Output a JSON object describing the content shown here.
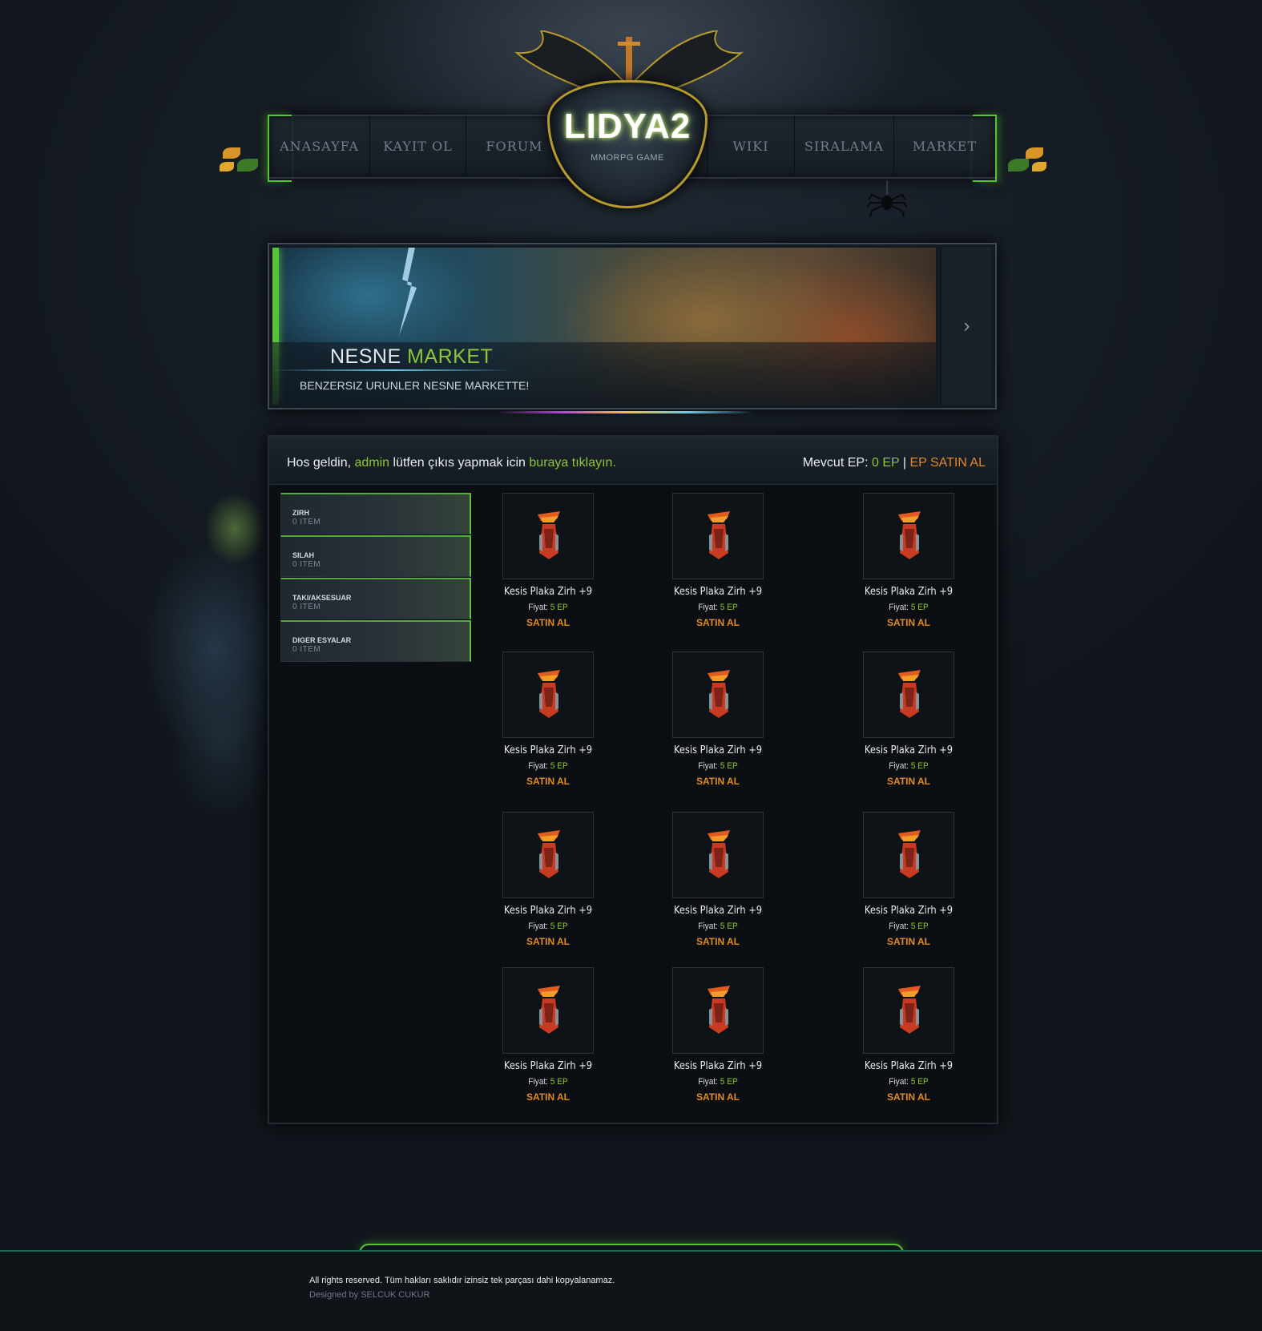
{
  "nav": {
    "items": [
      {
        "label": "ANASAYFA"
      },
      {
        "label": "KAYIT OL"
      },
      {
        "label": "FORUM"
      },
      {
        "label": "WIKI"
      },
      {
        "label": "SIRALAMA"
      },
      {
        "label": "MARKET"
      }
    ]
  },
  "logo": {
    "title": "LIDYA2",
    "subtitle": "MMORPG GAME"
  },
  "banner": {
    "title_part1": "NESNE",
    "title_part2": "MARKET",
    "subtitle": "BENZERSIZ URUNLER NESNE MARKETTE!",
    "next_symbol": "›"
  },
  "welcome": {
    "prefix": "Hos geldin,",
    "username": "admin",
    "middle": "lütfen çıkıs yapmak icin",
    "link": "buraya tıklayın."
  },
  "ep": {
    "label": "Mevcut EP:",
    "value": "0 EP",
    "separator": "|",
    "buy_label": "EP SATIN AL"
  },
  "categories": [
    {
      "name": "ZIRH",
      "count": "0 ITEM"
    },
    {
      "name": "SILAH",
      "count": "0 ITEM"
    },
    {
      "name": "TAKI/AKSESUAR",
      "count": "0 ITEM"
    },
    {
      "name": "DIGER ESYALAR",
      "count": "0 ITEM"
    }
  ],
  "items": [
    {
      "name": "Kesis Plaka Zirh +9",
      "price_label": "Fiyat:",
      "price": "5 EP",
      "buy": "SATIN AL"
    },
    {
      "name": "Kesis Plaka Zirh +9",
      "price_label": "Fiyat:",
      "price": "5 EP",
      "buy": "SATIN AL"
    },
    {
      "name": "Kesis Plaka Zirh +9",
      "price_label": "Fiyat:",
      "price": "5 EP",
      "buy": "SATIN AL"
    },
    {
      "name": "Kesis Plaka Zirh +9",
      "price_label": "Fiyat:",
      "price": "5 EP",
      "buy": "SATIN AL"
    },
    {
      "name": "Kesis Plaka Zirh +9",
      "price_label": "Fiyat:",
      "price": "5 EP",
      "buy": "SATIN AL"
    },
    {
      "name": "Kesis Plaka Zirh +9",
      "price_label": "Fiyat:",
      "price": "5 EP",
      "buy": "SATIN AL"
    },
    {
      "name": "Kesis Plaka Zirh +9",
      "price_label": "Fiyat:",
      "price": "5 EP",
      "buy": "SATIN AL"
    },
    {
      "name": "Kesis Plaka Zirh +9",
      "price_label": "Fiyat:",
      "price": "5 EP",
      "buy": "SATIN AL"
    },
    {
      "name": "Kesis Plaka Zirh +9",
      "price_label": "Fiyat:",
      "price": "5 EP",
      "buy": "SATIN AL"
    },
    {
      "name": "Kesis Plaka Zirh +9",
      "price_label": "Fiyat:",
      "price": "5 EP",
      "buy": "SATIN AL"
    },
    {
      "name": "Kesis Plaka Zirh +9",
      "price_label": "Fiyat:",
      "price": "5 EP",
      "buy": "SATIN AL"
    },
    {
      "name": "Kesis Plaka Zirh +9",
      "price_label": "Fiyat:",
      "price": "5 EP",
      "buy": "SATIN AL"
    }
  ],
  "footer": {
    "copyright": "All rights reserved. Tüm hakları saklıdır izinsiz tek parçası dahi kopyalanamaz.",
    "designer": "Designed by SELCUK CUKUR"
  },
  "colors": {
    "accent_green": "#8ec63a",
    "accent_orange": "#e08a22",
    "frame_green": "#58c23a",
    "logo_gold": "#b79a2c"
  },
  "icons": {
    "item": "armor-icon",
    "banner_next": "chevron-right-icon",
    "decor": [
      "bat-wings-icon",
      "spider-icon",
      "leaf-ornament-icon",
      "lightning-icon"
    ]
  }
}
